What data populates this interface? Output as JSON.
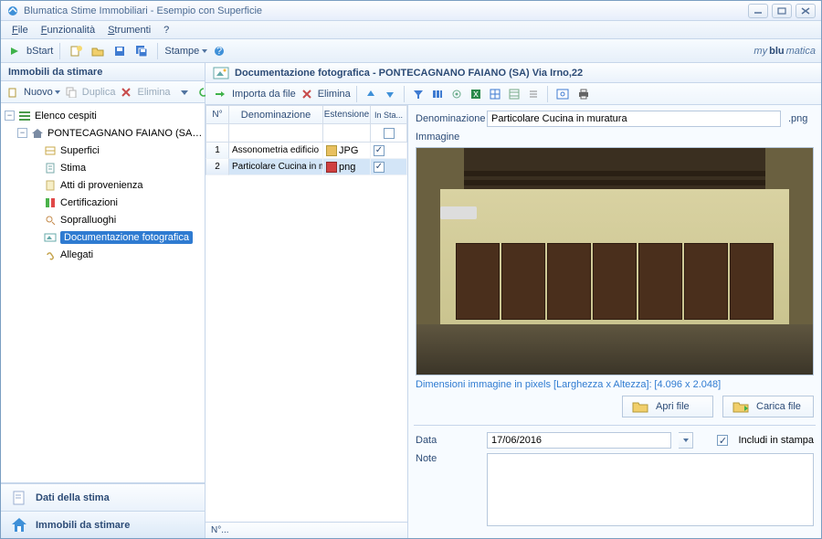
{
  "window": {
    "title": "Blumatica Stime Immobiliari - Esempio con Superficie"
  },
  "menubar": [
    "File",
    "Funzionalità",
    "Strumenti",
    "?"
  ],
  "toolbar": {
    "bstart": "bStart",
    "stampe": "Stampe"
  },
  "brand_prefix": "my",
  "brand_main": "blu",
  "brand_suffix": "matica",
  "sidebar": {
    "title": "Immobili da stimare",
    "toolbar": {
      "nuovo": "Nuovo",
      "duplica": "Duplica",
      "elimina": "Elimina"
    },
    "tree": {
      "root": "Elenco cespiti",
      "property": "PONTECAGNANO FAIANO (SA) Via Irno,22",
      "children": [
        "Superfici",
        "Stima",
        "Atti di provenienza",
        "Certificazioni",
        "Sopralluoghi",
        "Documentazione fotografica",
        "Allegati"
      ]
    },
    "nav": [
      "Dati della stima",
      "Immobili da stimare"
    ]
  },
  "doc": {
    "title": "Documentazione fotografica - PONTECAGNANO FAIANO (SA) Via Irno,22",
    "toolbar": {
      "importa": "Importa da file",
      "elimina": "Elimina"
    }
  },
  "grid": {
    "headers": [
      "N°",
      "Denominazione",
      "Estensione",
      "In Sta..."
    ],
    "rows": [
      {
        "n": "1",
        "name": "Assonometria edificio",
        "ext": "JPG",
        "stampa": true
      },
      {
        "n": "2",
        "name": "Particolare Cucina in muratura",
        "ext": "png",
        "stampa": true
      }
    ],
    "status": "N°..."
  },
  "detail": {
    "labels": {
      "denominazione": "Denominazione",
      "immagine": "Immagine",
      "data": "Data",
      "note": "Note",
      "includi": "Includi in stampa",
      "apri": "Apri file",
      "carica": "Carica file"
    },
    "denominazione_value": "Particolare Cucina in muratura",
    "ext_value": ".png",
    "dim_label": "Dimensioni immagine in pixels [Larghezza x Altezza]:",
    "dim_value": "[4.096 x 2.048]",
    "data_value": "17/06/2016",
    "includi_checked": true
  }
}
